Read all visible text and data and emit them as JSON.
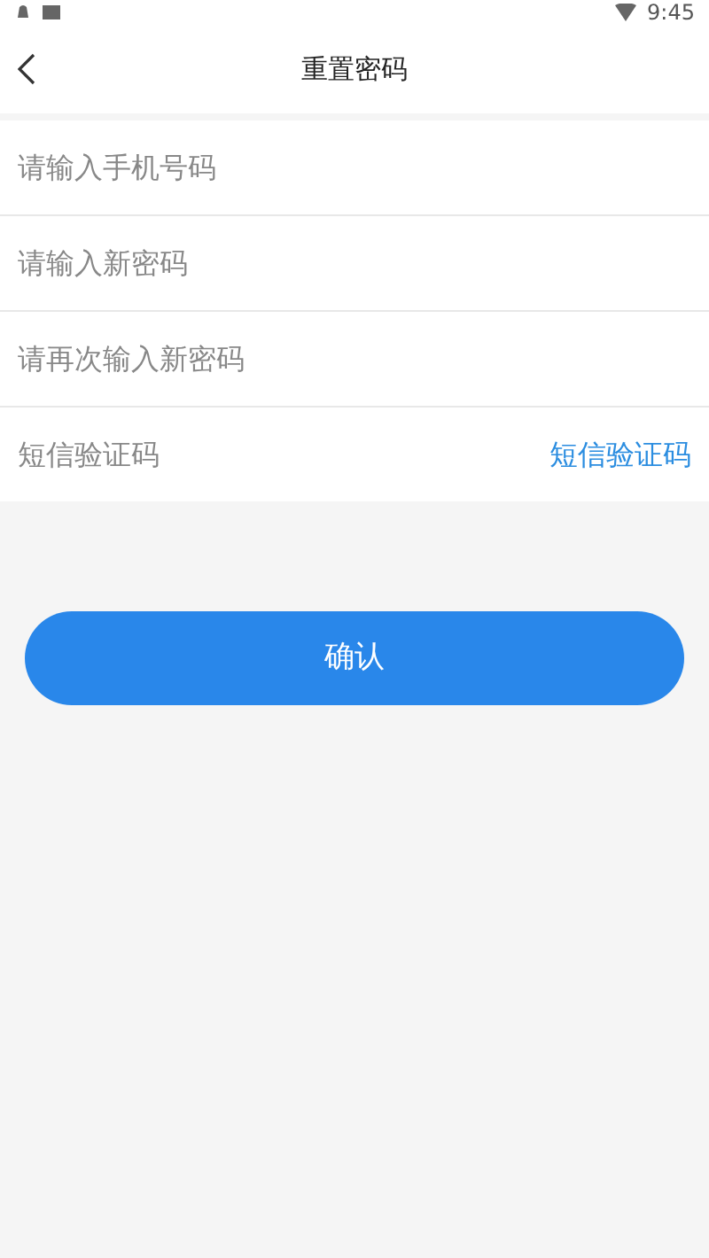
{
  "status_bar": {
    "time": "9:45"
  },
  "header": {
    "title": "重置密码"
  },
  "fields": [
    {
      "placeholder": "请输入手机号码"
    },
    {
      "placeholder": "请输入新密码"
    },
    {
      "placeholder": "请再次输入新密码"
    },
    {
      "placeholder": "短信验证码",
      "action": "短信验证码"
    }
  ],
  "confirm_button": "确认"
}
